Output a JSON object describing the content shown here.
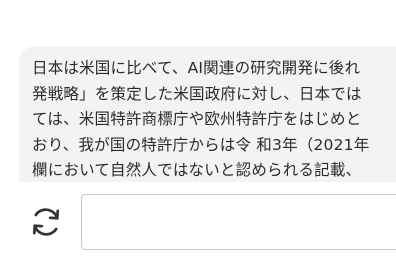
{
  "message": {
    "lines": [
      "日本は米国に比べて、AI関連の研究開発に後れ",
      "発戦略」を策定した米国政府に対し、日本では",
      "ては、米国特許商標庁や欧州特許庁をはじめと",
      "おり、我が国の特許庁からは令 和3年（2021年",
      "欄において自然人ではないと認められる記載、"
    ]
  },
  "composer": {
    "input_value": "",
    "input_placeholder": ""
  },
  "icons": {
    "regenerate": "refresh-icon"
  },
  "colors": {
    "bubble_background": "#f3f3f3",
    "text": "#2b2b2b",
    "input_border": "#c8c8c8"
  }
}
